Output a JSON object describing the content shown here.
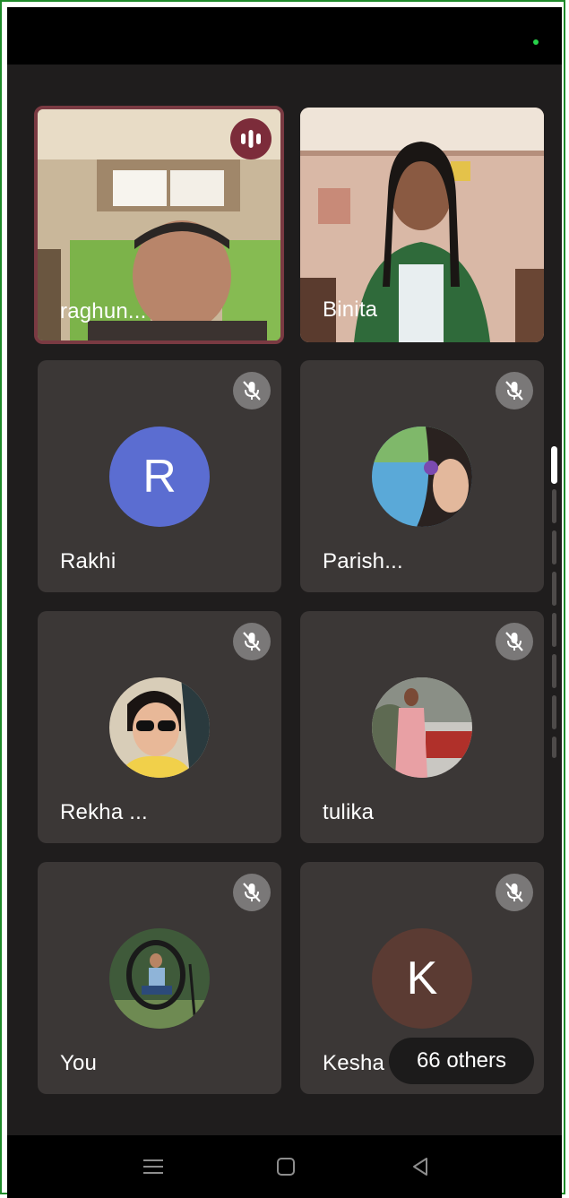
{
  "participants": [
    {
      "name": "raghun...",
      "state": "speaking",
      "video": true,
      "speaking_icon": "audio-bars-icon"
    },
    {
      "name": "Binita",
      "state": "video",
      "video": true
    },
    {
      "name": "Rakhi",
      "state": "muted",
      "avatar_initial": "R",
      "avatar_color": "#5b6dd1",
      "mute_icon": "mic-off-icon"
    },
    {
      "name": "Parish...",
      "state": "muted",
      "avatar_type": "photo",
      "mute_icon": "mic-off-icon"
    },
    {
      "name": "Rekha ...",
      "state": "muted",
      "avatar_type": "photo",
      "mute_icon": "mic-off-icon"
    },
    {
      "name": "tulika",
      "state": "muted",
      "avatar_type": "photo",
      "mute_icon": "mic-off-icon"
    },
    {
      "name": "You",
      "state": "muted",
      "avatar_type": "photo",
      "mute_icon": "mic-off-icon"
    },
    {
      "name": "Kesha",
      "state": "muted",
      "avatar_initial": "K",
      "avatar_color": "#5b3b33",
      "mute_icon": "mic-off-icon"
    }
  ],
  "others_chip": {
    "label": "66 others"
  },
  "colors": {
    "background": "#1f1d1d",
    "tile": "#3b3736",
    "active_border": "#7a3a42",
    "frame": "#1f8a2a"
  },
  "nav": {
    "icons": [
      "menu-icon",
      "home-icon",
      "back-icon"
    ]
  }
}
